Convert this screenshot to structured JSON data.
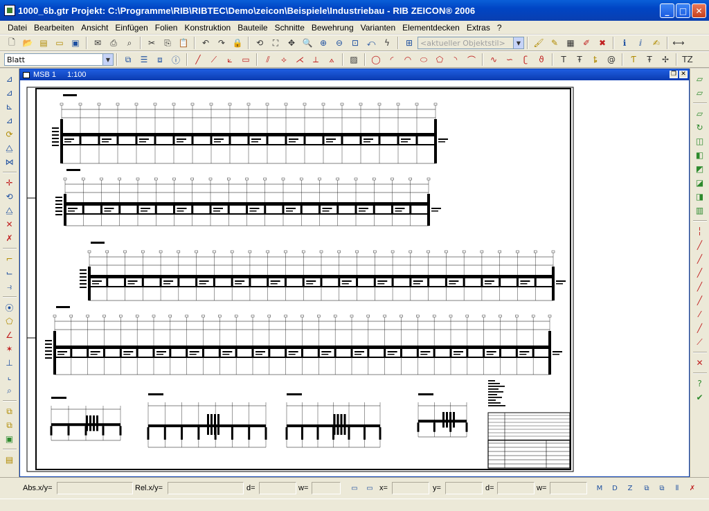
{
  "window": {
    "title": "1000_6b.gtr  Projekt: C:\\Programme\\RIB\\RIBTEC\\Demo\\zeicon\\Beispiele\\Industriebau  -  RIB ZEICON® 2006",
    "min_label": "_",
    "max_label": "□",
    "close_label": "✕"
  },
  "menu": [
    "Datei",
    "Bearbeiten",
    "Ansicht",
    "Einfügen",
    "Folien",
    "Konstruktion",
    "Bauteile",
    "Schnitte",
    "Bewehrung",
    "Varianten",
    "Elementdecken",
    "Extras",
    "?"
  ],
  "toolbar1": {
    "style_placeholder": "<aktueller Objektstil>"
  },
  "toolbar2": {
    "layer_value": "Blatt"
  },
  "document": {
    "name": "MSB 1",
    "scale": "1:100"
  },
  "status": {
    "abs_label": "Abs.x/y=",
    "rel_label": "Rel.x/y=",
    "d1_label": "d=",
    "w1_label": "w=",
    "x_label": "x=",
    "y_label": "y=",
    "d2_label": "d=",
    "w2_label": "w="
  },
  "colors": {
    "titlebar": "#0a5fd8",
    "chrome": "#ece9d8",
    "drawing": "#000000"
  }
}
